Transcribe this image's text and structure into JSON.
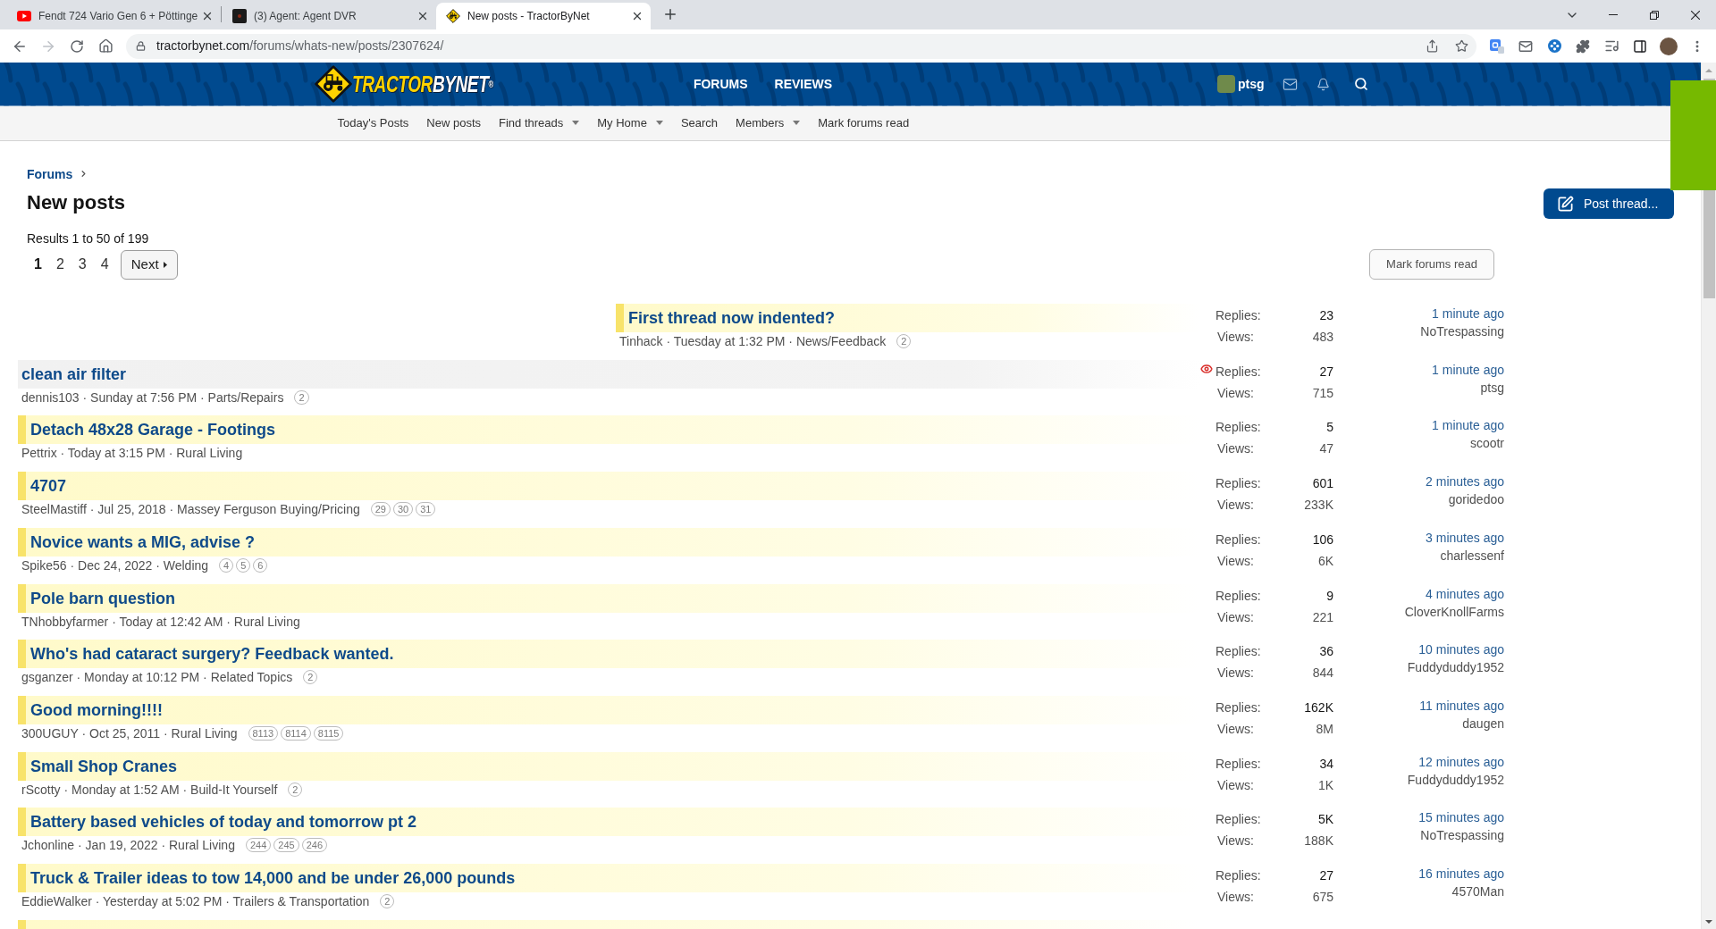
{
  "browser": {
    "tabs": [
      {
        "kind": "video",
        "title": "Fendt 724 Vario Gen 6 + Pöttinge",
        "selected": false
      },
      {
        "kind": "app",
        "title": "(3) Agent: Agent DVR",
        "selected": false
      },
      {
        "kind": "site",
        "title": "New posts - TractorByNet",
        "selected": true
      }
    ],
    "forward_disabled": true,
    "url": {
      "host": "tractorbynet.com",
      "path": "/forums/whats-new/posts/2307624/"
    }
  },
  "site_header": {
    "logo": {
      "word_1": "TRACTOR",
      "word_2": "BYNET",
      "mark": "®"
    },
    "nav": [
      {
        "label": "FORUMS"
      },
      {
        "label": "REVIEWS"
      }
    ],
    "user": {
      "name": "ptsg"
    }
  },
  "sub_nav": [
    {
      "label": "Today's Posts",
      "dropdown": false
    },
    {
      "label": "New posts",
      "dropdown": false
    },
    {
      "label": "Find threads",
      "dropdown": true
    },
    {
      "label": "My Home",
      "dropdown": true
    },
    {
      "label": "Search",
      "dropdown": false
    },
    {
      "label": "Members",
      "dropdown": true
    },
    {
      "label": "Mark forums read",
      "dropdown": false
    }
  ],
  "breadcrumb": [
    {
      "label": "Forums"
    }
  ],
  "page_title": "New posts",
  "post_thread_button": "Post thread...",
  "results": "Results 1 to 50 of 199",
  "pagination": {
    "pages": [
      {
        "label": "1",
        "selected": true
      },
      {
        "label": "2",
        "selected": false
      },
      {
        "label": "3",
        "selected": false
      },
      {
        "label": "4",
        "selected": false
      }
    ],
    "next": "Next"
  },
  "mark_read_button": "Mark forums read",
  "threads": [
    {
      "title": "First thread now indented?",
      "meta": "Tinhack · Tuesday at 1:32 PM · News/Feedback",
      "pages": [
        "2"
      ],
      "highlighted": true,
      "watched": false,
      "stats": [
        {
          "label": "Replies:",
          "value": "23"
        },
        {
          "label": "Views:",
          "value": "483"
        }
      ],
      "last_post": {
        "time": "1 minute ago",
        "user": "NoTrespassing"
      }
    },
    {
      "title": "clean air filter",
      "meta": "dennis103 · Sunday at 7:56 PM · Parts/Repairs",
      "pages": [
        "2"
      ],
      "highlighted": false,
      "watched": true,
      "stats": [
        {
          "label": "Replies:",
          "value": "27"
        },
        {
          "label": "Views:",
          "value": "715"
        }
      ],
      "last_post": {
        "time": "1 minute ago",
        "user": "ptsg"
      }
    },
    {
      "title": "Detach 48x28 Garage - Footings",
      "meta": "Pettrix · Today at 3:15 PM · Rural Living",
      "highlighted": true,
      "watched": false,
      "stats": [
        {
          "label": "Replies:",
          "value": "5"
        },
        {
          "label": "Views:",
          "value": "47"
        }
      ],
      "last_post": {
        "time": "1 minute ago",
        "user": "scootr"
      }
    },
    {
      "title": "4707",
      "meta": "SteelMastiff · Jul 25, 2018 · Massey Ferguson Buying/Pricing",
      "pages": [
        "29",
        "30",
        "31"
      ],
      "highlighted": true,
      "watched": false,
      "stats": [
        {
          "label": "Replies:",
          "value": "601"
        },
        {
          "label": "Views:",
          "value": "233K"
        }
      ],
      "last_post": {
        "time": "2 minutes ago",
        "user": "goridedoo"
      }
    },
    {
      "title": "Novice wants a MIG, advise ?",
      "meta": "Spike56 · Dec 24, 2022 · Welding",
      "pages": [
        "4",
        "5",
        "6"
      ],
      "highlighted": true,
      "watched": false,
      "stats": [
        {
          "label": "Replies:",
          "value": "106"
        },
        {
          "label": "Views:",
          "value": "6K"
        }
      ],
      "last_post": {
        "time": "3 minutes ago",
        "user": "charlessenf"
      }
    },
    {
      "title": "Pole barn question",
      "meta": "TNhobbyfarmer · Today at 12:42 AM · Rural Living",
      "highlighted": true,
      "watched": false,
      "stats": [
        {
          "label": "Replies:",
          "value": "9"
        },
        {
          "label": "Views:",
          "value": "221"
        }
      ],
      "last_post": {
        "time": "4 minutes ago",
        "user": "CloverKnollFarms"
      }
    },
    {
      "title": "Who's had cataract surgery? Feedback wanted.",
      "meta": "gsganzer · Monday at 10:12 PM · Related Topics",
      "pages": [
        "2"
      ],
      "highlighted": true,
      "watched": false,
      "stats": [
        {
          "label": "Replies:",
          "value": "36"
        },
        {
          "label": "Views:",
          "value": "844"
        }
      ],
      "last_post": {
        "time": "10 minutes ago",
        "user": "Fuddyduddy1952"
      }
    },
    {
      "title": "Good morning!!!!",
      "meta": "300UGUY · Oct 25, 2011 · Rural Living",
      "pages": [
        "8113",
        "8114",
        "8115"
      ],
      "highlighted": true,
      "watched": false,
      "stats": [
        {
          "label": "Replies:",
          "value": "162K"
        },
        {
          "label": "Views:",
          "value": "8M"
        }
      ],
      "last_post": {
        "time": "11 minutes ago",
        "user": "daugen"
      }
    },
    {
      "title": "Small Shop Cranes",
      "meta": "rScotty · Monday at 1:52 AM · Build-It Yourself",
      "pages": [
        "2"
      ],
      "highlighted": true,
      "watched": false,
      "stats": [
        {
          "label": "Replies:",
          "value": "34"
        },
        {
          "label": "Views:",
          "value": "1K"
        }
      ],
      "last_post": {
        "time": "12 minutes ago",
        "user": "Fuddyduddy1952"
      }
    },
    {
      "title": "Battery based vehicles of today and tomorrow pt 2",
      "meta": "Jchonline · Jan 19, 2022 · Rural Living",
      "pages": [
        "244",
        "245",
        "246"
      ],
      "highlighted": true,
      "watched": false,
      "stats": [
        {
          "label": "Replies:",
          "value": "5K"
        },
        {
          "label": "Views:",
          "value": "188K"
        }
      ],
      "last_post": {
        "time": "15 minutes ago",
        "user": "NoTrespassing"
      }
    },
    {
      "title": "Truck & Trailer ideas to tow 14,000 and be under 26,000 pounds",
      "meta": "EddieWalker · Yesterday at 5:02 PM · Trailers & Transportation",
      "pages": [
        "2"
      ],
      "highlighted": true,
      "watched": false,
      "stats": [
        {
          "label": "Replies:",
          "value": "27"
        },
        {
          "label": "Views:",
          "value": "675"
        }
      ],
      "last_post": {
        "time": "16 minutes ago",
        "user": "4570Man"
      }
    },
    {
      "highlighted": true
    }
  ]
}
